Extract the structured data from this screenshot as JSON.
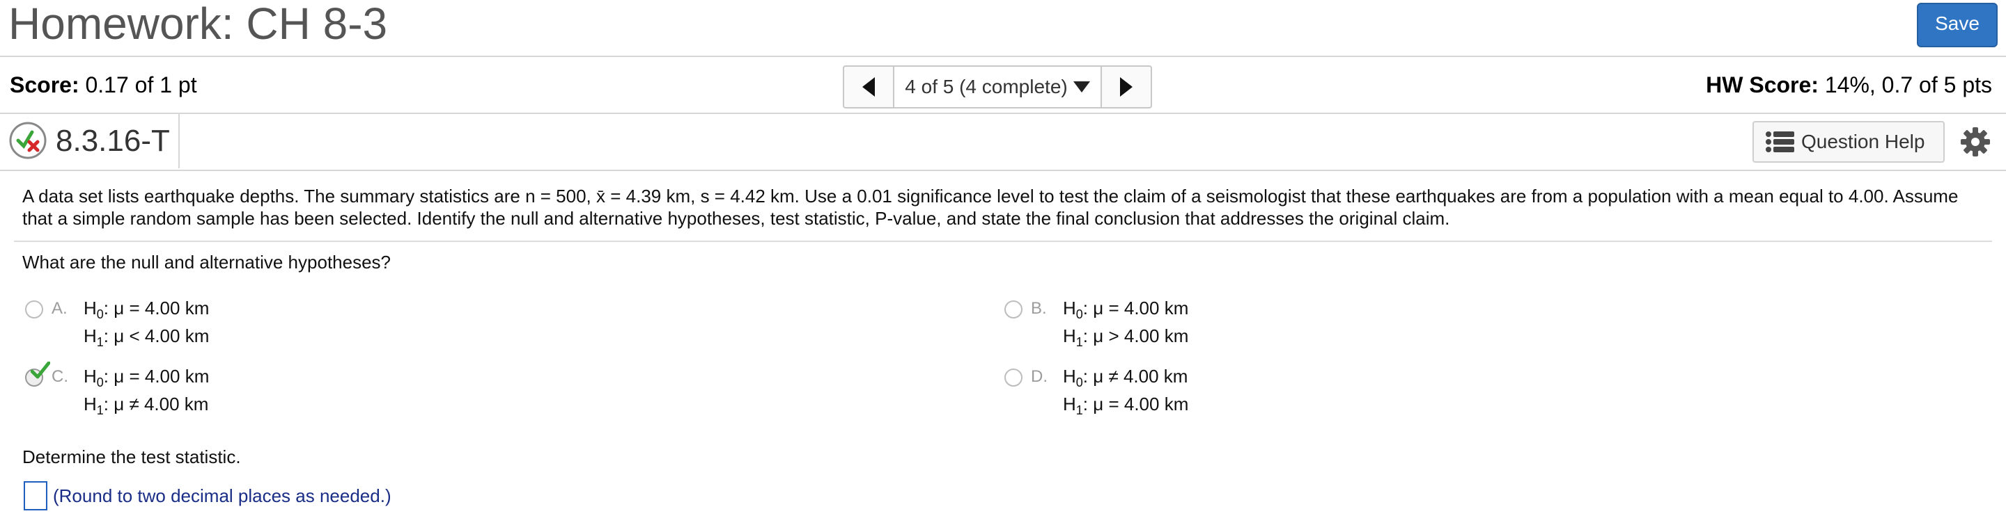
{
  "header": {
    "title": "Homework: CH 8-3",
    "save_label": "Save"
  },
  "scorebar": {
    "score_label": "Score:",
    "score_value": "0.17 of 1 pt",
    "nav_text": "4 of 5 (4 complete)",
    "hw_score_label": "HW Score:",
    "hw_score_value": "14%, 0.7 of 5 pts"
  },
  "question_bar": {
    "id": "8.3.16-T",
    "help_label": "Question Help"
  },
  "problem": {
    "prompt_line1": "A data set lists earthquake depths. The summary statistics are n = 500, x̄ = 4.39 km, s = 4.42 km. Use a 0.01 significance level to test the claim of a seismologist that these earthquakes are from a population with a mean equal to 4.00. Assume",
    "prompt_line2": "that a simple random sample has been selected. Identify the null and alternative hypotheses, test statistic, P-value, and state the final conclusion that addresses the original claim.",
    "q1": "What are the null and alternative hypotheses?",
    "options": [
      {
        "letter": "A.",
        "h0": "μ = 4.00 km",
        "h1": "μ < 4.00 km",
        "selected": false
      },
      {
        "letter": "B.",
        "h0": "μ = 4.00 km",
        "h1": "μ > 4.00 km",
        "selected": false
      },
      {
        "letter": "C.",
        "h0": "μ = 4.00 km",
        "h1": "μ ≠ 4.00 km",
        "selected": true
      },
      {
        "letter": "D.",
        "h0": "μ ≠ 4.00 km",
        "h1": "μ = 4.00 km",
        "selected": false
      }
    ],
    "h0_prefix": "H",
    "h0_sub": "0",
    "h1_prefix": "H",
    "h1_sub": "1",
    "colon": ":",
    "q2": "Determine the test statistic.",
    "round_note": "(Round to two decimal places as needed.)"
  },
  "colors": {
    "accent": "#2f75c4",
    "correct": "#3aa63a",
    "incorrect": "#d62828",
    "note": "#1a2d86"
  },
  "icons": [
    "partial-credit-icon",
    "list-icon",
    "gear-icon",
    "chevron-left-icon",
    "chevron-right-icon",
    "caret-down-icon",
    "checkmark-icon"
  ]
}
